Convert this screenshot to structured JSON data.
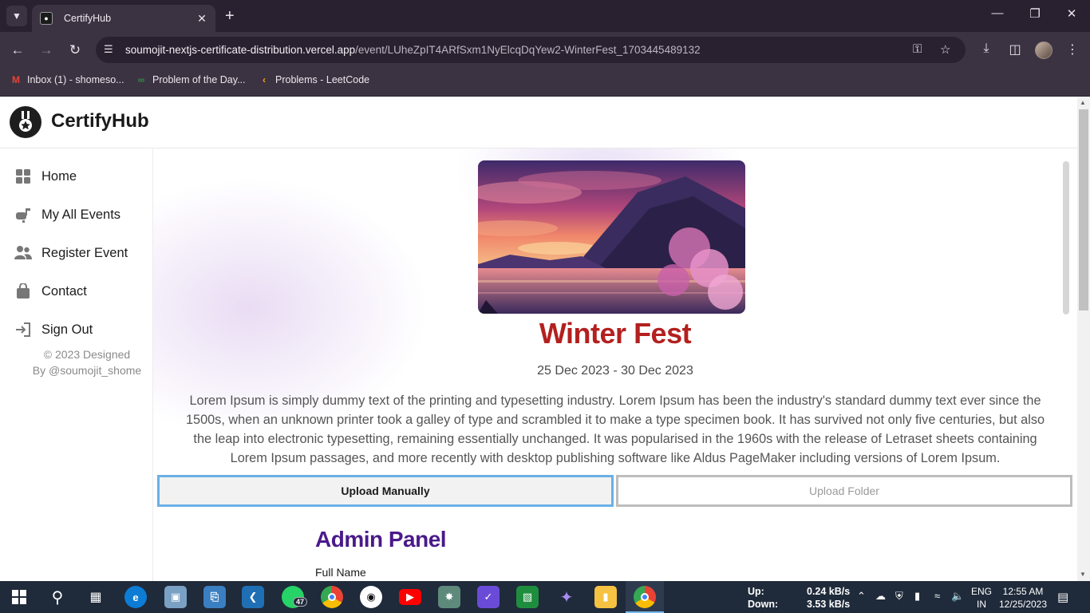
{
  "browser": {
    "tab_title": "CertifyHub",
    "url_host": "soumojit-nextjs-certificate-distribution.vercel.app",
    "url_path": "/event/LUheZpIT4ARfSxm1NyElcqDqYew2-WinterFest_1703445489132",
    "bookmarks": [
      {
        "label": "Inbox (1) - shomeso...",
        "icon": "gmail-icon"
      },
      {
        "label": "Problem of the Day...",
        "icon": "gfg-icon"
      },
      {
        "label": "Problems - LeetCode",
        "icon": "leetcode-icon"
      }
    ]
  },
  "app": {
    "brand": "CertifyHub",
    "nav": [
      {
        "label": "Home",
        "icon": "grid-icon"
      },
      {
        "label": "My All Events",
        "icon": "mailbox-icon"
      },
      {
        "label": "Register Event",
        "icon": "users-icon"
      },
      {
        "label": "Contact",
        "icon": "bag-icon"
      },
      {
        "label": "Sign Out",
        "icon": "sign-out-icon"
      }
    ],
    "footer_line1": "© 2023 Designed",
    "footer_line2": "By @soumojit_shome"
  },
  "event": {
    "title": "Winter Fest",
    "dates": "25 Dec 2023 - 30 Dec 2023",
    "description": "Lorem Ipsum is simply dummy text of the printing and typesetting industry. Lorem Ipsum has been the industry's standard dummy text ever since the 1500s, when an unknown printer took a galley of type and scrambled it to make a type specimen book. It has survived not only five centuries, but also the leap into electronic typesetting, remaining essentially unchanged. It was popularised in the 1960s with the release of Letraset sheets containing Lorem Ipsum passages, and more recently with desktop publishing software like Aldus PageMaker including versions of Lorem Ipsum."
  },
  "upload": {
    "manual_label": "Upload Manually",
    "folder_label": "Upload Folder"
  },
  "admin": {
    "title": "Admin Panel",
    "full_name_label": "Full Name"
  },
  "taskbar": {
    "whatsapp_badge": "47",
    "net_up_label": "Up:",
    "net_down_label": "Down:",
    "net_up": "0.24 kB/s",
    "net_down": "3.53 kB/s",
    "lang_line1": "ENG",
    "lang_line2": "IN",
    "time": "12:55 AM",
    "date": "12/25/2023"
  },
  "colors": {
    "event_title": "#b3201f",
    "admin_title": "#4a1a8a",
    "active_tab_border": "#6ab0e6"
  }
}
